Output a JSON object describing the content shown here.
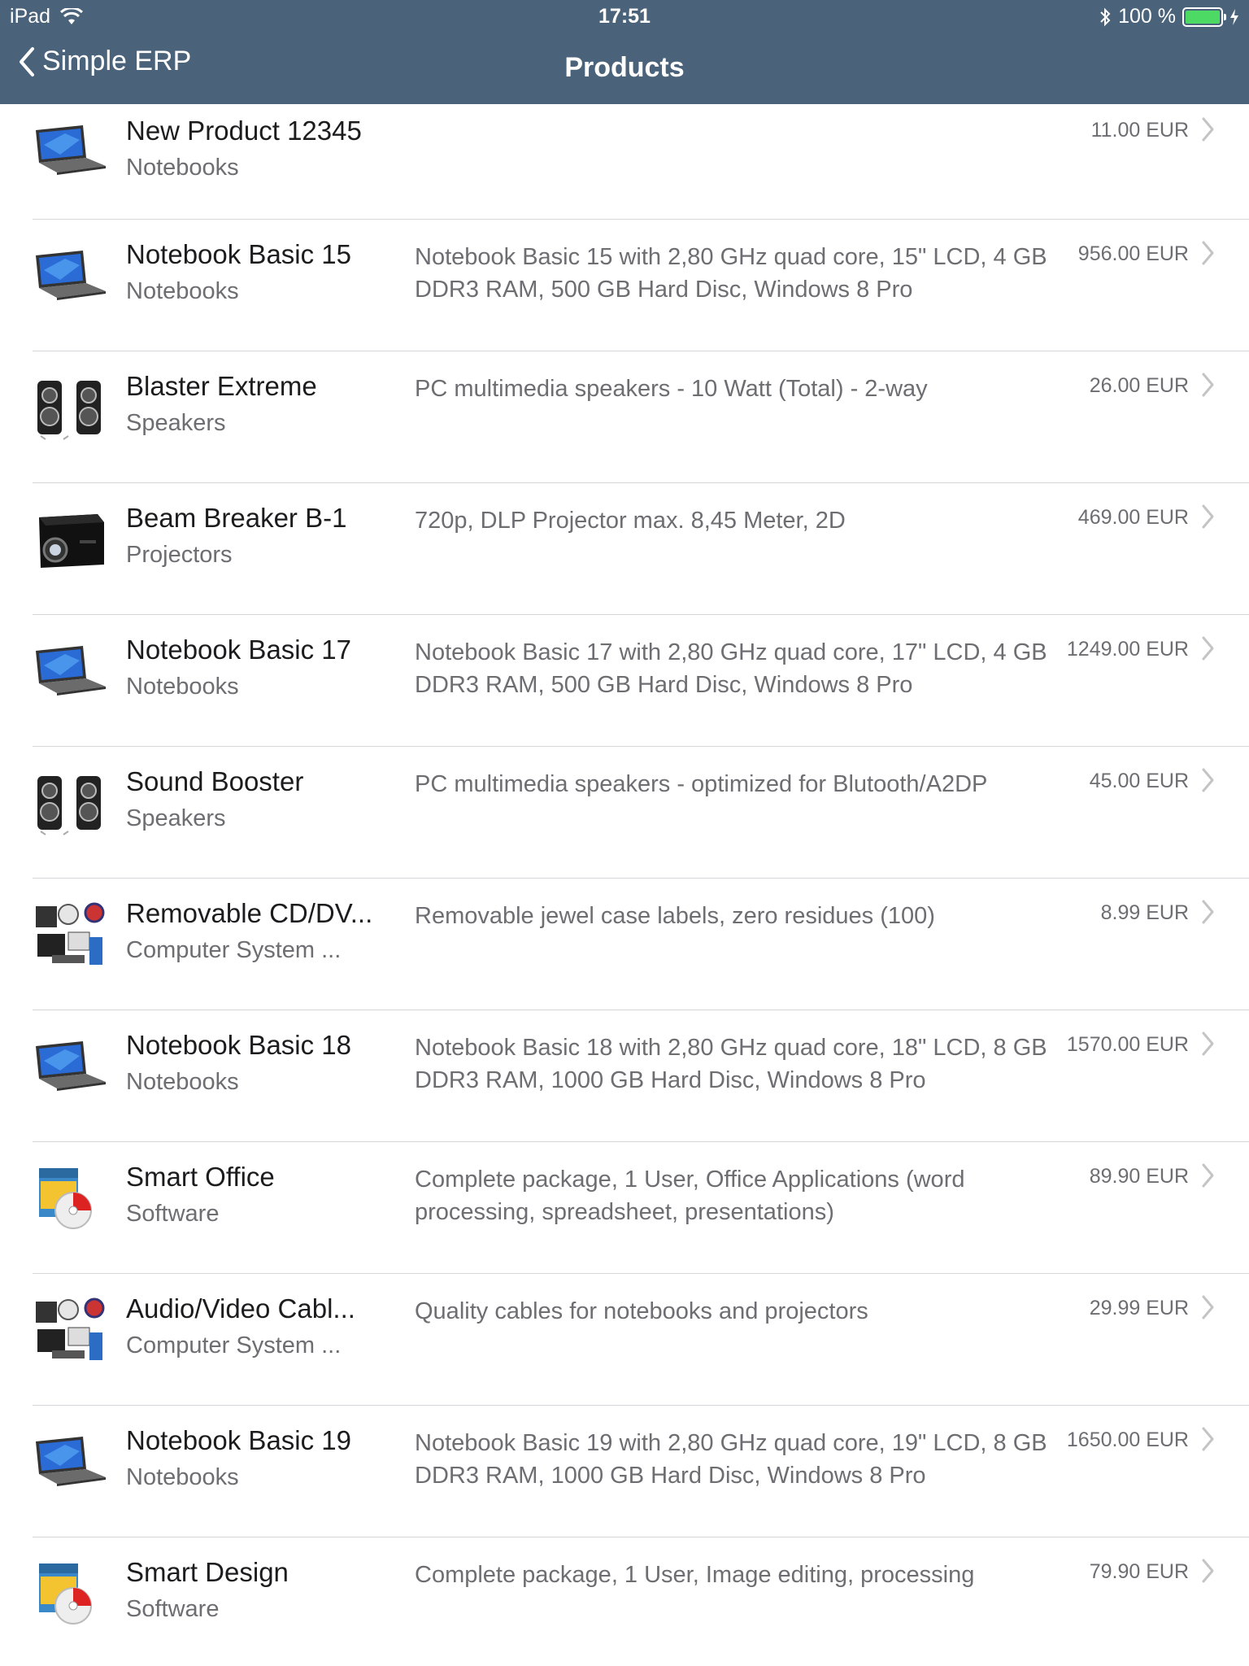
{
  "status": {
    "device": "iPad",
    "time": "17:51",
    "battery": "100 %"
  },
  "nav": {
    "back_label": "Simple ERP",
    "title": "Products"
  },
  "currency": "EUR",
  "colors": {
    "nav_bg": "#4a637a",
    "battery_fill": "#4cd964",
    "secondary_text": "#6d6d72",
    "separator": "#d7d7db"
  },
  "products": [
    {
      "name": "New Product 12345",
      "category": "Notebooks",
      "description": "",
      "price": "11.00 EUR",
      "image": "laptop"
    },
    {
      "name": "Notebook Basic 15",
      "category": "Notebooks",
      "description": "Notebook Basic 15 with 2,80 GHz quad core, 15\" LCD, 4 GB DDR3 RAM, 500 GB Hard Disc, Windows 8 Pro",
      "price": "956.00 EUR",
      "image": "laptop"
    },
    {
      "name": "Blaster Extreme",
      "category": "Speakers",
      "description": "PC multimedia speakers - 10 Watt (Total) - 2-way",
      "price": "26.00 EUR",
      "image": "speakers"
    },
    {
      "name": "Beam Breaker B-1",
      "category": "Projectors",
      "description": "720p, DLP Projector max. 8,45 Meter, 2D",
      "price": "469.00 EUR",
      "image": "projector"
    },
    {
      "name": "Notebook Basic 17",
      "category": "Notebooks",
      "description": "Notebook Basic 17 with 2,80 GHz quad core, 17\" LCD, 4 GB DDR3 RAM, 500 GB Hard Disc, Windows 8 Pro",
      "price": "1249.00 EUR",
      "image": "laptop"
    },
    {
      "name": "Sound Booster",
      "category": "Speakers",
      "description": "PC multimedia speakers - optimized for Blutooth/A2DP",
      "price": "45.00 EUR",
      "image": "speakers"
    },
    {
      "name": "Removable CD/DV...",
      "category": "Computer System ...",
      "description": "Removable jewel case labels, zero residues (100)",
      "price": "8.99 EUR",
      "image": "components"
    },
    {
      "name": "Notebook Basic 18",
      "category": "Notebooks",
      "description": "Notebook Basic 18 with 2,80 GHz quad core, 18\" LCD, 8 GB DDR3 RAM, 1000 GB Hard Disc, Windows 8 Pro",
      "price": "1570.00 EUR",
      "image": "laptop"
    },
    {
      "name": "Smart Office",
      "category": "Software",
      "description": "Complete package, 1 User, Office Applications (word processing, spreadsheet, presentations)",
      "price": "89.90 EUR",
      "image": "software"
    },
    {
      "name": "Audio/Video Cabl...",
      "category": "Computer System ...",
      "description": "Quality cables for notebooks and projectors",
      "price": "29.99 EUR",
      "image": "components"
    },
    {
      "name": "Notebook Basic 19",
      "category": "Notebooks",
      "description": "Notebook Basic 19 with 2,80 GHz quad core, 19\" LCD, 8 GB DDR3 RAM, 1000 GB Hard Disc, Windows 8 Pro",
      "price": "1650.00 EUR",
      "image": "laptop"
    },
    {
      "name": "Smart Design",
      "category": "Software",
      "description": "Complete package, 1 User, Image editing, processing",
      "price": "79.90 EUR",
      "image": "software"
    }
  ]
}
